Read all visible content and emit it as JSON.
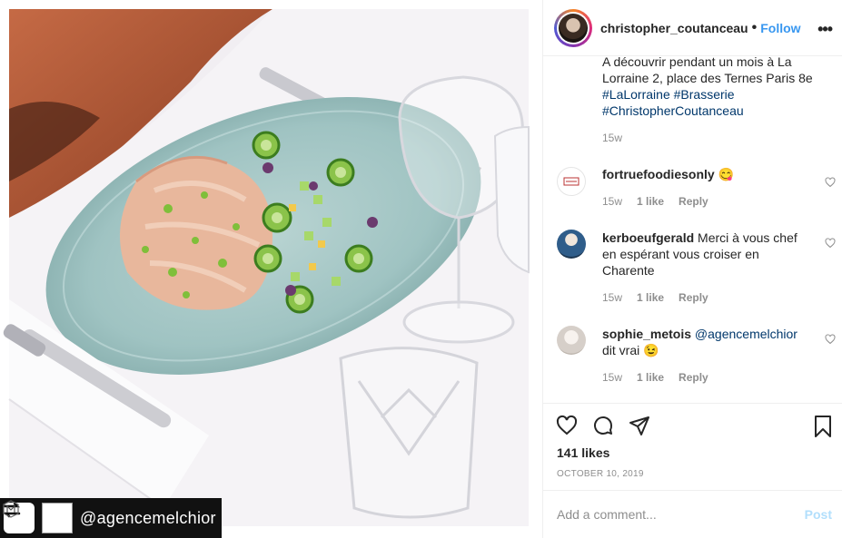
{
  "photo": {
    "alt_subject": "plated fish carpaccio with cucumber rolls",
    "repost": {
      "handle": "@agencemelchior"
    }
  },
  "header": {
    "username": "christopher_coutanceau",
    "separator": "•",
    "follow_label": "Follow",
    "more_label": "•••"
  },
  "caption": {
    "line1": "A découvrir pendant un mois à La Lorraine 2, place des Ternes Paris 8e",
    "tags": [
      "#LaLorraine",
      "#Brasserie",
      "#ChristopherCoutanceau"
    ],
    "time": "15w"
  },
  "comments": [
    {
      "user": "fortruefoodiesonly",
      "text": "😋",
      "time": "15w",
      "likes": "",
      "reply": "Reply"
    },
    {
      "user": "kerboeufgerald",
      "text": "Merci à vous chef en espérant vous croiser en Charente",
      "time": "15w",
      "likes": "1 like",
      "reply": "Reply"
    },
    {
      "user": "sophie_metois",
      "mention": "@agencemelchior",
      "text": "dit vrai 😉",
      "time": "15w",
      "likes": "1 like",
      "reply": "Reply"
    }
  ],
  "comment0_likes": "1 like",
  "actions": {
    "likes": "141 likes",
    "date": "OCTOBER 10, 2019"
  },
  "add_comment": {
    "placeholder": "Add a comment...",
    "post_label": "Post"
  },
  "colors": {
    "accent": "#3897f0",
    "tag": "#00376b",
    "meta": "#8e8e8e"
  }
}
